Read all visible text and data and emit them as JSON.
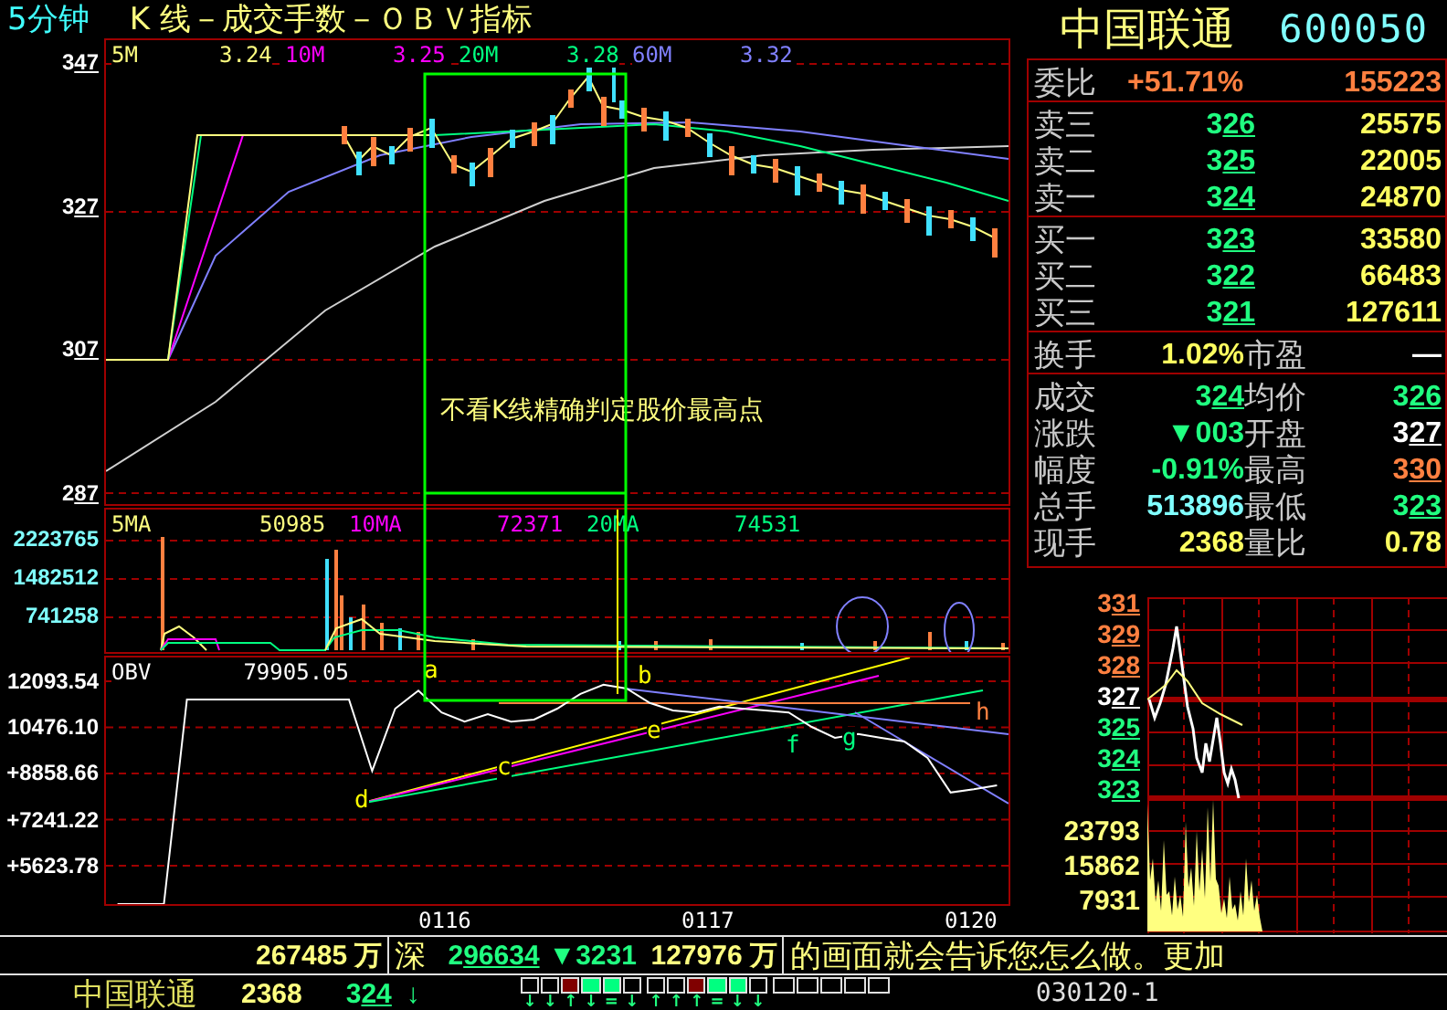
{
  "title": {
    "period": "5分钟",
    "name": "K 线－成交手数－ＯＢＶ指标"
  },
  "price_panel": {
    "legend": [
      {
        "label": "5M",
        "value": "3.24",
        "color": "#ffff80"
      },
      {
        "label": "10M",
        "value": "3.25",
        "color": "#ff00ff"
      },
      {
        "label": "20M",
        "value": "3.28",
        "color": "#00ff80"
      },
      {
        "label": "60M",
        "value": "3.32",
        "color": "#8080ff"
      }
    ],
    "axis": [
      "347",
      "327",
      "307",
      "287"
    ],
    "annotation": "不看K线精确判定股价最高点"
  },
  "volume_panel": {
    "legend": [
      {
        "label": "5MA",
        "value": "50985",
        "color": "#ffff80"
      },
      {
        "label": "10MA",
        "value": "72371",
        "color": "#ff00ff"
      },
      {
        "label": "20MA",
        "value": "74531",
        "color": "#00ff80"
      }
    ],
    "axis": [
      "2223765",
      "1482512",
      "741258"
    ]
  },
  "obv_panel": {
    "legend": [
      {
        "value": "79905.05",
        "color": "#ffffff"
      }
    ],
    "chart_data": {
      "type": "line",
      "ylim": [
        4278.58,
        12926.28
      ],
      "grid": true,
      "yticks": [
        {
          "value": 12093.54,
          "label": "12093.54"
        },
        {
          "value": 10476.1,
          "label": "10476.10"
        },
        {
          "value": 8858.66,
          "label": "+8858.66"
        },
        {
          "value": 7241.22,
          "label": "+7241.22"
        },
        {
          "value": 5623.78,
          "label": "+5623.78"
        }
      ],
      "series": [
        {
          "name": "OBV",
          "color": "#ffffff",
          "values": [
            4280,
            4280,
            4280,
            11450,
            11450,
            11450,
            11450,
            11450,
            11450,
            11450,
            11450,
            8950,
            11130,
            11770,
            11000,
            10680,
            10940,
            10680,
            10750,
            11130,
            11650,
            11970,
            11840,
            11330,
            11070,
            11000,
            11200,
            11130,
            11070,
            11000,
            10490,
            10110,
            10240,
            10110,
            9980,
            9400,
            8190,
            8310,
            8440
          ]
        }
      ]
    },
    "points": [
      {
        "label": "a",
        "color": "#ffff00"
      },
      {
        "label": "b",
        "color": "#ffff00"
      },
      {
        "label": "c",
        "color": "#ffff00"
      },
      {
        "label": "d",
        "color": "#ffff00"
      },
      {
        "label": "e",
        "color": "#ffff00"
      },
      {
        "label": "f",
        "color": "#00ff80"
      },
      {
        "label": "g",
        "color": "#00ff80"
      },
      {
        "label": "h",
        "color": "#ff8040"
      }
    ]
  },
  "time_axis": [
    "0116",
    "0117",
    "0120"
  ],
  "quote": {
    "name": "中国联通",
    "code": "600050",
    "ratio": {
      "label": "委比",
      "percent": "+51.71%",
      "volume": "155223"
    },
    "asks": [
      {
        "label": "卖三",
        "price": "326",
        "volume": "25575"
      },
      {
        "label": "卖二",
        "price": "325",
        "volume": "22005"
      },
      {
        "label": "卖一",
        "price": "324",
        "volume": "24870"
      }
    ],
    "bids": [
      {
        "label": "买一",
        "price": "323",
        "volume": "33580"
      },
      {
        "label": "买二",
        "price": "322",
        "volume": "66483"
      },
      {
        "label": "买三",
        "price": "321",
        "volume": "127611"
      }
    ],
    "turnover": [
      {
        "label": "换手",
        "value": "1.02%",
        "kind": "number",
        "color": "#ffff60"
      },
      {
        "label": "市盈",
        "value": "—",
        "kind": "number"
      }
    ],
    "stats": [
      [
        {
          "label": "成交",
          "value": "324",
          "kind": "price",
          "color": "#20ff80"
        },
        {
          "label": "均价",
          "value": "326",
          "kind": "price",
          "color": "#20ff80"
        }
      ],
      [
        {
          "label": "涨跌",
          "value": "▼003",
          "kind": "number",
          "color": "#20ff80"
        },
        {
          "label": "开盘",
          "value": "327",
          "kind": "price",
          "color": "#ffffff"
        }
      ],
      [
        {
          "label": "幅度",
          "value": "-0.91%",
          "kind": "number",
          "color": "#20ff80"
        },
        {
          "label": "最高",
          "value": "330",
          "kind": "price",
          "color": "#ff8040"
        }
      ],
      [
        {
          "label": "总手",
          "value": "513896",
          "kind": "number",
          "color": "#80ffff"
        },
        {
          "label": "最低",
          "value": "323",
          "kind": "price",
          "color": "#20ff80"
        }
      ],
      [
        {
          "label": "现手",
          "value": "2368",
          "kind": "number",
          "color": "#ffff60"
        },
        {
          "label": "量比",
          "value": "0.78",
          "kind": "number",
          "color": "#ffff60"
        }
      ]
    ]
  },
  "mini_chart": {
    "price_axis": [
      {
        "text": "331",
        "color": "#ff8040"
      },
      {
        "text": "329",
        "color": "#ff8040"
      },
      {
        "text": "328",
        "color": "#ff8040"
      },
      {
        "text": "327",
        "color": "#ffffff"
      },
      {
        "text": "325",
        "color": "#20ff80"
      },
      {
        "text": "324",
        "color": "#20ff80"
      },
      {
        "text": "323",
        "color": "#20ff80"
      }
    ],
    "volume_axis": [
      "23793",
      "15862",
      "7931"
    ]
  },
  "status_bar": {
    "market": [
      {
        "text": "267485 万",
        "kind": "amount"
      },
      {
        "text": "深",
        "kind": "exchange"
      },
      {
        "text": "296634",
        "kind": "index"
      },
      {
        "text": "▼3231",
        "kind": "change"
      },
      {
        "text": "127976 万",
        "kind": "amount"
      }
    ],
    "ticker": "的画面就会告诉您怎么做。更加",
    "stock": {
      "name": "中国联通",
      "volume": "2368",
      "price": "324",
      "arrow": "↓"
    },
    "signals": [
      {
        "cells": [
          {
            "lit": false
          },
          {
            "lit": false
          },
          {
            "lit": true,
            "color": "#800000"
          },
          {
            "lit": true,
            "color": "#00ff80"
          },
          {
            "lit": true,
            "color": "#00ff80"
          },
          {
            "lit": false
          }
        ],
        "arrows": [
          "↓",
          "↓",
          "↑",
          "↓",
          "=",
          "↓"
        ]
      },
      {
        "cells": [
          {
            "lit": false
          },
          {
            "lit": false
          },
          {
            "lit": true,
            "color": "#800000"
          },
          {
            "lit": true,
            "color": "#00ff80"
          },
          {
            "lit": true,
            "color": "#00ff80"
          },
          {
            "lit": false
          }
        ],
        "arrows": [
          "↑",
          "↑",
          "↑",
          "=",
          "↓",
          "↓"
        ]
      },
      {
        "cells": [
          {
            "lit": false
          },
          {
            "lit": false
          },
          {
            "lit": false
          },
          {
            "lit": false
          },
          {
            "lit": false
          }
        ]
      }
    ],
    "date": "030120-1"
  }
}
